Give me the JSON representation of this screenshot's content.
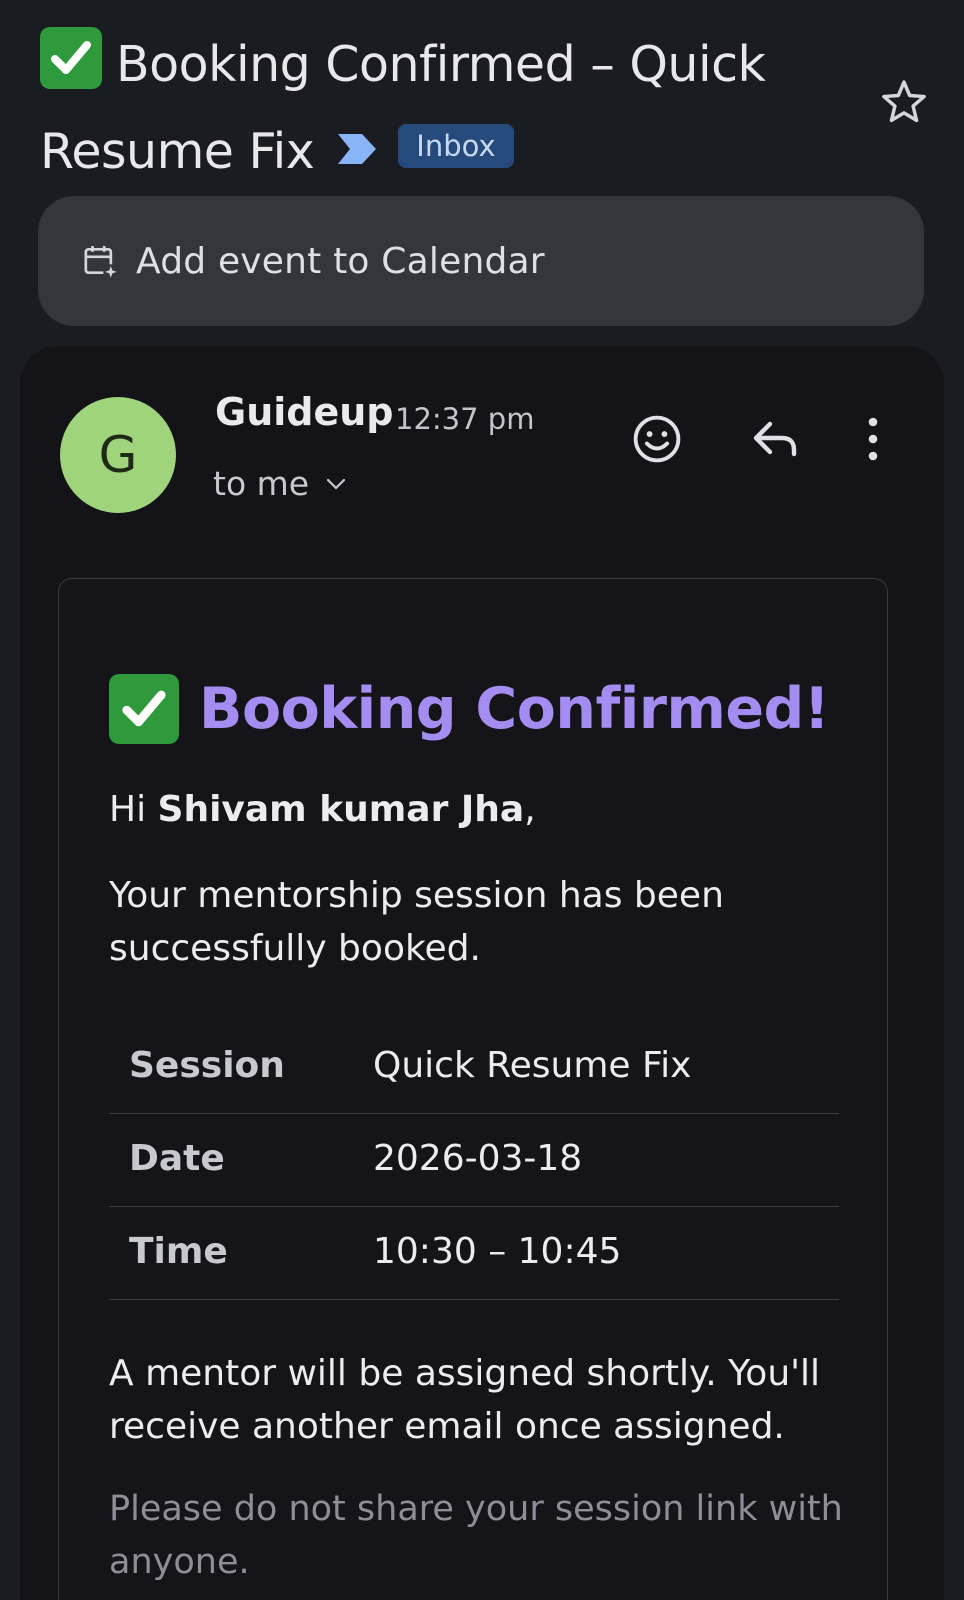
{
  "subject": {
    "icon": "check-mark-emoji-icon",
    "text": "Booking Confirmed – Quick Resume Fix",
    "importance_icon": "importance-marker-icon",
    "label_chip": "Inbox"
  },
  "actions": {
    "star_icon": "star-outline-icon"
  },
  "calendar_bar": {
    "icon": "calendar-add-icon",
    "label": "Add event to Calendar"
  },
  "message": {
    "avatar_letter": "G",
    "avatar_color": "#9fd37c",
    "sender": "Guideup",
    "time": "12:37 pm",
    "recipient": "to me",
    "icons": [
      "emoji-react-icon",
      "reply-icon",
      "more-vert-icon"
    ]
  },
  "email": {
    "title": "Booking Confirmed!",
    "title_color": "#a58cf0",
    "greeting_prefix": "Hi ",
    "greeting_name": "Shivam kumar Jha",
    "greeting_suffix": ",",
    "intro": "Your mentorship session has been successfully booked.",
    "details": [
      {
        "label": "Session",
        "value": "Quick Resume Fix"
      },
      {
        "label": "Date",
        "value": "2026-03-18"
      },
      {
        "label": "Time",
        "value": "10:30 – 10:45"
      }
    ],
    "note": "A mentor will be assigned shortly. You'll receive another email once assigned.",
    "disclaimer": "Please do not share your session link with anyone."
  }
}
